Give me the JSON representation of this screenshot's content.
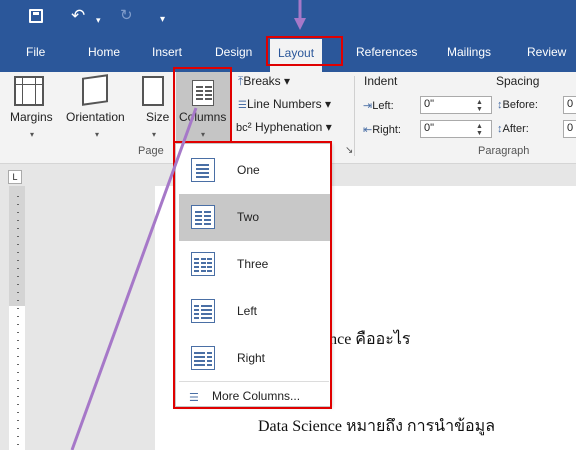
{
  "title_bar": {
    "accent_color": "#2b579a",
    "qat_more": "▾"
  },
  "tabs": [
    "File",
    "Home",
    "Insert",
    "Design",
    "Layout",
    "References",
    "Mailings",
    "Review"
  ],
  "active_tab": "Layout",
  "ribbon": {
    "margins": "Margins",
    "orientation": "Orientation",
    "size": "Size",
    "columns": "Columns",
    "breaks": "Breaks",
    "line_numbers": "Line Numbers",
    "hyphenation": "Hyphenation",
    "page_setup_group": "Page",
    "indent_title": "Indent",
    "indent_left_label": "Left:",
    "indent_left_value": "0\"",
    "indent_right_label": "Right:",
    "indent_right_value": "0\"",
    "spacing_title": "Spacing",
    "spacing_before_label": "Before:",
    "spacing_before_value": "0",
    "spacing_after_label": "After:",
    "spacing_after_value": "0",
    "paragraph_group": "Paragraph",
    "hyphen_prefix": "bc",
    "dialog_launcher": "↘"
  },
  "columns_menu": {
    "items": [
      {
        "label": "One",
        "icon": "one-column-icon",
        "selected": false
      },
      {
        "label": "Two",
        "icon": "two-columns-icon",
        "selected": true
      },
      {
        "label": "Three",
        "icon": "three-columns-icon",
        "selected": false
      },
      {
        "label": "Left",
        "icon": "left-column-icon",
        "selected": false
      },
      {
        "label": "Right",
        "icon": "right-column-icon",
        "selected": false
      }
    ],
    "more": "More Columns..."
  },
  "document": {
    "line1": "ence คืออะไร",
    "line2": "Data Science หมายถึง การนำข้อมูล"
  },
  "ruler_corner": "L",
  "highlight_color": "#e00000",
  "arrow_color": "#a678c8"
}
